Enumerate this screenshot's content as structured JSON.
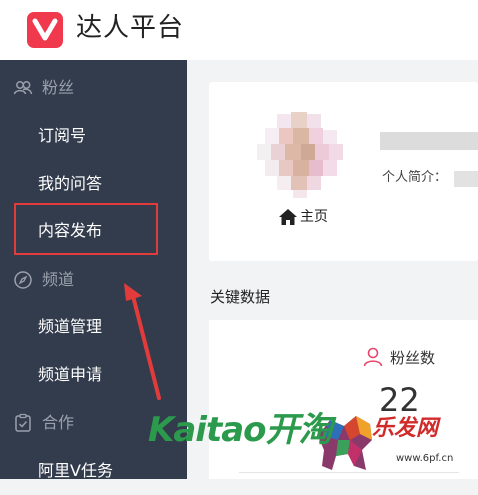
{
  "header": {
    "app_title": "达人平台",
    "logo_icon": "v-logo-icon",
    "brand_color": "#f0394d"
  },
  "sidebar": {
    "sections": [
      {
        "label": "粉丝",
        "icon": "fans-icon",
        "items": [
          "订阅号",
          "我的问答",
          "内容发布"
        ]
      },
      {
        "label": "频道",
        "icon": "compass-icon",
        "items": [
          "频道管理",
          "频道申请"
        ]
      },
      {
        "label": "合作",
        "icon": "clipboard-check-icon",
        "items": [
          "阿里V任务"
        ]
      }
    ],
    "background": "#333c4d"
  },
  "profile": {
    "home_label": "主页",
    "bio_label": "个人简介："
  },
  "key_data": {
    "title": "关键数据",
    "fans_label": "粉丝数",
    "fans_count": "22"
  },
  "watermark": {
    "brand": "Kaitao开淘",
    "site_name": "乐发网",
    "url": "www.6pf.cn"
  }
}
